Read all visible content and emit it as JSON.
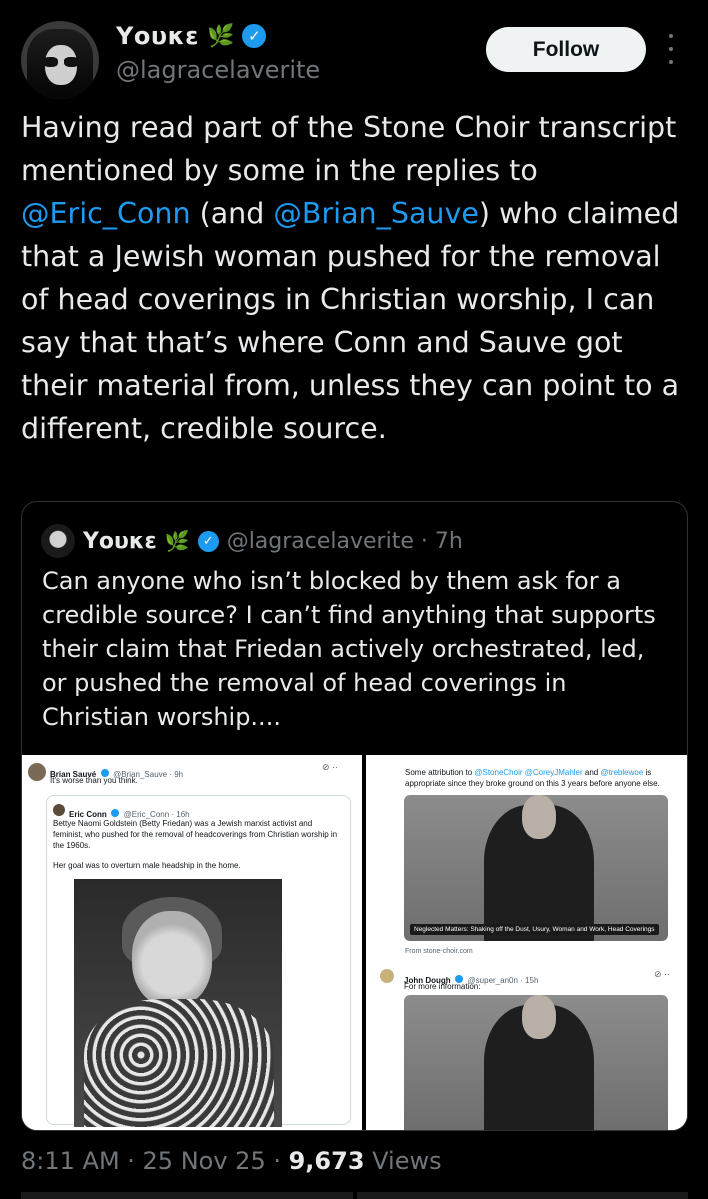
{
  "author": {
    "display_name": "Yουκε",
    "handle": "@lagracelaverite",
    "badge_emoji": "🌿"
  },
  "actions": {
    "follow_label": "Follow"
  },
  "tweet": {
    "text_part1": "Having read part of the Stone Choir transcript mentioned by some in the replies to ",
    "mention1": "@Eric_Conn",
    "text_part2": " (and ",
    "mention2": "@Brian_Sauve",
    "text_part3": ") who claimed that a Jewish woman pushed for the removal of head coverings in Christian worship, I can say that that’s where Conn and Sauve got their material from, unless they can point to a different, credible source."
  },
  "quote": {
    "display_name": "Yουκε",
    "badge_emoji": "🌿",
    "handle_time": "@lagracelaverite · 7h",
    "text": "Can anyone who isn’t blocked by them ask for a credible source? I can’t find anything that supports their claim that Friedan actively orchestrated, led, or pushed the removal of head coverings in Christian worship...."
  },
  "screenshot_left": {
    "author": "Brian Sauvé",
    "meta": "@Brian_Sauve · 9h",
    "text": "It's worse than you think.",
    "inner_author": "Eric Conn",
    "inner_meta": "@Eric_Conn · 16h",
    "inner_text": "Bettye Naomi Goldstein (Betty Friedan) was a Jewish marxist activist and feminist, who pushed for the removal of headcoverings from Christian worship in the 1960s.",
    "inner_text2": "Her goal was to overturn male headship in the home."
  },
  "screenshot_right": {
    "text_prefix": "Some attribution to ",
    "mentions": "@StoneChoir @CoreyJMahler",
    "text_and": " and ",
    "mention3": "@treblewoe",
    "text_suffix": " is appropriate since they broke ground on this 3 years before anyone else.",
    "card_caption": "Neglected Matters: Shaking off the Dust, Usury, Woman and Work, Head Coverings",
    "card_source": "From stone-choir.com",
    "reply_author": "John Dough",
    "reply_meta": "@super_an0n · 15h",
    "reply_text": "For more information:"
  },
  "footer": {
    "time_date": "8:11 AM · 25 Nov 25 · ",
    "views_count": "9,673",
    "views_label": " Views"
  },
  "colors": {
    "background": "#000000",
    "text": "#e7e9ea",
    "muted": "#71767b",
    "link": "#1d9bf0",
    "verified": "#1d9bf0"
  }
}
